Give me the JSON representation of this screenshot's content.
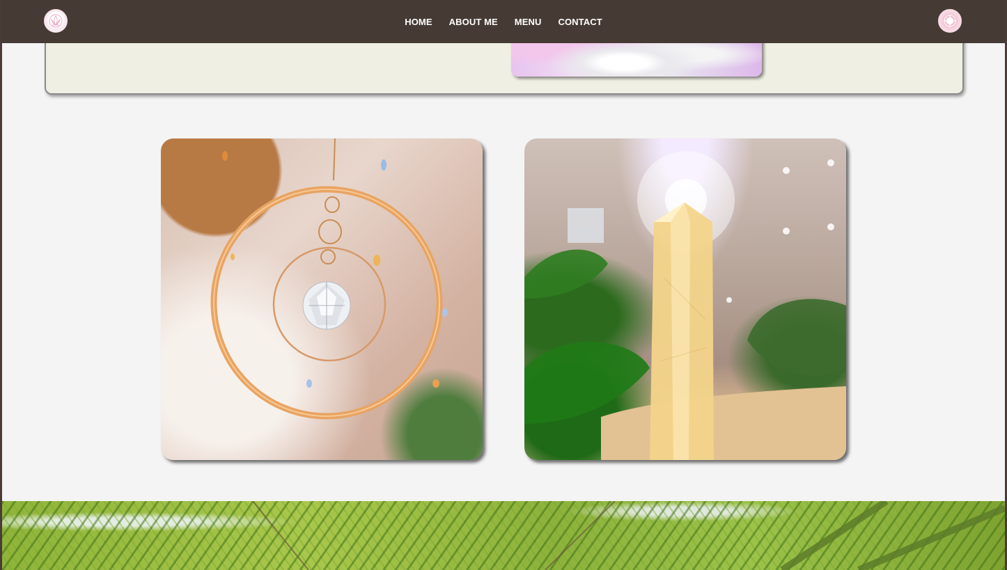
{
  "header": {
    "logo_left_icon": "lotus-logo-icon",
    "logo_right_icon": "mandala-badge-icon",
    "nav": [
      {
        "label": "HOME"
      },
      {
        "label": "ABOUT ME"
      },
      {
        "label": "MENU"
      },
      {
        "label": "CONTACT"
      }
    ]
  },
  "top_section": {
    "image": "white-flower-photo"
  },
  "gallery": {
    "photos": [
      {
        "subject": "crystal-suncatcher-photo"
      },
      {
        "subject": "citrine-crystal-point-photo"
      }
    ]
  },
  "footer_banner": {
    "image": "bamboo-leaves-photo"
  },
  "colors": {
    "header_bg": "#463b34",
    "page_bg": "#f4f4f4",
    "card_bg": "#efefe4",
    "nav_text": "#ffffff"
  }
}
